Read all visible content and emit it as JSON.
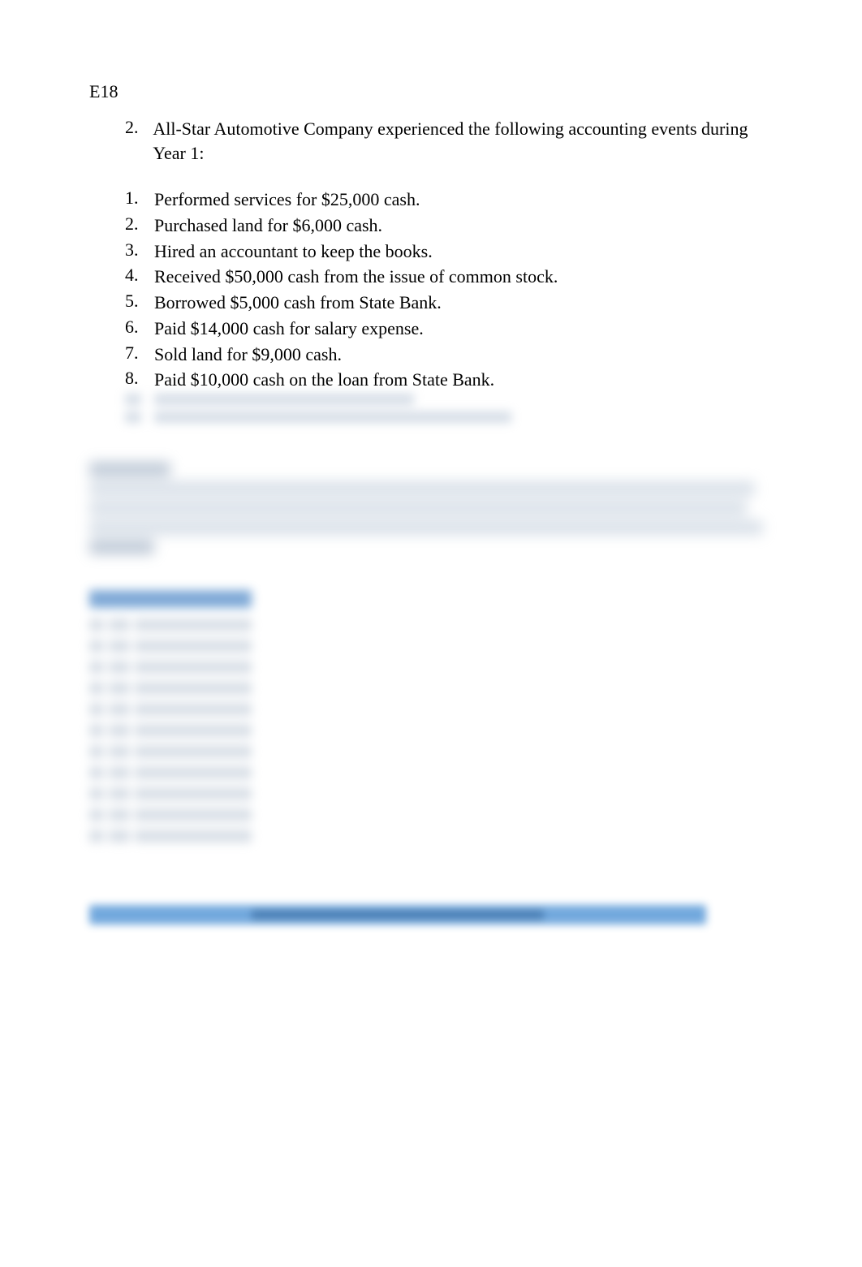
{
  "label": "E18",
  "intro": {
    "number": "2.",
    "text": "All-Star Automotive Company experienced the following accounting events during Year 1:"
  },
  "events": [
    {
      "num": "1.",
      "text": "Performed services for $25,000 cash."
    },
    {
      "num": "2.",
      "text": "Purchased land for $6,000 cash."
    },
    {
      "num": "3.",
      "text": "Hired an accountant to keep the books."
    },
    {
      "num": "4.",
      "text": "Received $50,000 cash from the issue of common stock."
    },
    {
      "num": "5.",
      "text": "Borrowed $5,000 cash from State Bank."
    },
    {
      "num": "6.",
      "text": "Paid $14,000 cash for salary expense."
    },
    {
      "num": "7.",
      "text": "Sold land for $9,000 cash."
    },
    {
      "num": "8.",
      "text": "Paid $10,000 cash on the loan from State Bank."
    }
  ]
}
